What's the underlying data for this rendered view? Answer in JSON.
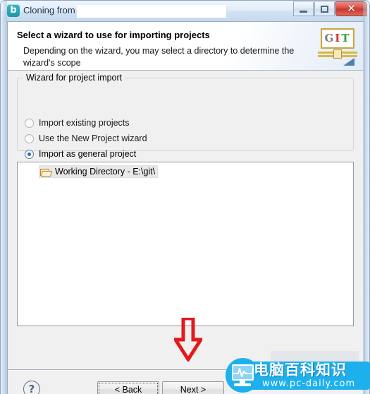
{
  "window": {
    "title": "Cloning from",
    "icon_name": "b-app-icon",
    "icon_letter": "b",
    "title_field_value": "",
    "controls": {
      "minimize_label": "Minimize",
      "maximize_label": "Maximize",
      "close_label": "Close",
      "close_glyph": "✕"
    }
  },
  "header": {
    "title": "Select a wizard to use for importing projects",
    "description": "Depending on the wizard, you may select a directory to determine the wizard's scope",
    "logo": {
      "name": "git-logo",
      "letter_g": "G",
      "letter_i": "I",
      "letter_t": "T"
    }
  },
  "group": {
    "legend": "Wizard for project import",
    "options": [
      {
        "label": "Import existing projects",
        "selected": false
      },
      {
        "label": "Use the New Project wizard",
        "selected": false
      },
      {
        "label": "Import as general project",
        "selected": true
      }
    ]
  },
  "tree": {
    "items": [
      {
        "label": "Working Directory - E:\\git\\",
        "icon": "open-folder-icon",
        "selected": true
      }
    ]
  },
  "footer": {
    "help_glyph": "?",
    "back_label": "< Back",
    "next_label": "Next >"
  },
  "annotation": {
    "arrow": "down-arrow-annotation",
    "color": "#e3191e"
  },
  "watermark": {
    "site_name": "电脑百科知识",
    "url": "www.pc-daily.com",
    "brand_color": "#1eb0ec"
  },
  "colors": {
    "accent": "#2b71b8",
    "close_button": "#d9473c",
    "frame": "#c8d9ec",
    "dialog_bg": "#f0f0f0",
    "panel_bg": "#ffffff"
  }
}
